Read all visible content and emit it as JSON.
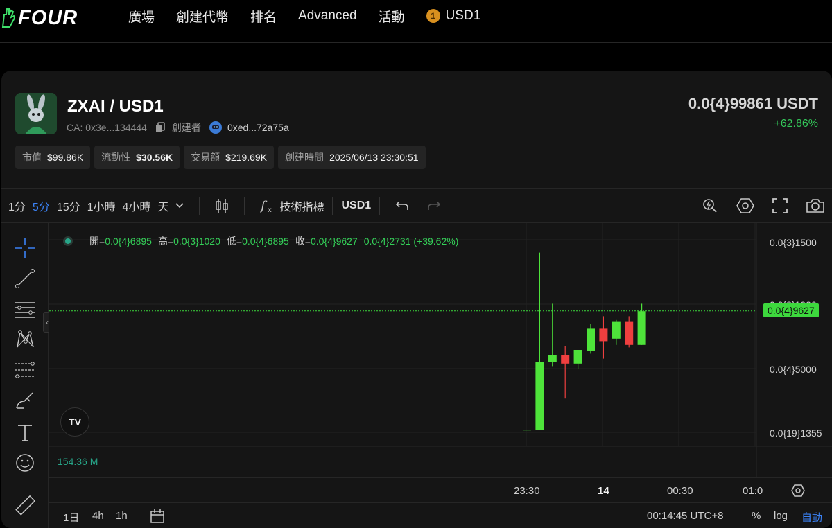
{
  "nav": {
    "logo_text": "FOUR",
    "items": [
      "廣場",
      "創建代幣",
      "排名",
      "Advanced",
      "活動"
    ],
    "token_badge": "1",
    "token_label": "USD1"
  },
  "token": {
    "pair": "ZXAI / USD1",
    "ca": "CA: 0x3e...134444",
    "creator_label": "創建者",
    "creator_address": "0xed...72a75a",
    "price": "0.0{4}99861 USDT",
    "change": "+62.86%"
  },
  "stats": [
    {
      "label": "市值",
      "value": "$99.86K",
      "bold": false
    },
    {
      "label": "流動性",
      "value": "$30.56K",
      "bold": true
    },
    {
      "label": "交易額",
      "value": "$219.69K",
      "bold": false
    },
    {
      "label": "創建時間",
      "value": "2025/06/13 23:30:51",
      "bold": false
    }
  ],
  "toolbar": {
    "timeframes": [
      "1分",
      "5分",
      "15分",
      "1小時",
      "4小時",
      "天"
    ],
    "active_timeframe": "5分",
    "indicators_label": "技術指標",
    "quote_label": "USD1"
  },
  "chart_data": {
    "type": "candlestick",
    "legend": {
      "open_label": "開=",
      "open": "0.0{4}6895",
      "high_label": "高=",
      "high": "0.0{3}1020",
      "low_label": "低=",
      "low": "0.0{4}6895",
      "close_label": "收=",
      "close": "0.0{4}9627",
      "change": "0.0{4}2731 (+39.62%)"
    },
    "y_tick_labels": [
      "0.0{3}1500",
      "0.0{3}1000",
      "0.0{4}5000",
      "0.0{19}1355"
    ],
    "current_price_label": "0.0{4}9627",
    "current_price": 9.627e-05,
    "x_tick_labels": [
      "23:30",
      "14",
      "00:30",
      "01:0"
    ],
    "ylim": [
      0,
      0.00015
    ],
    "candles": [
      {
        "open": 1e-06,
        "high": 1e-06,
        "low": 1e-06,
        "close": 1e-06
      },
      {
        "open": 1e-06,
        "high": 0.000143,
        "low": 1e-06,
        "close": 5.5e-05
      },
      {
        "open": 5.5e-05,
        "high": 0.000102,
        "low": 5.2e-05,
        "close": 6.1e-05
      },
      {
        "open": 6.1e-05,
        "high": 6.8e-05,
        "low": 2.6e-05,
        "close": 5.4e-05
      },
      {
        "open": 5.4e-05,
        "high": 6.4e-05,
        "low": 5e-05,
        "close": 6.5e-05
      },
      {
        "open": 6.4e-05,
        "high": 8.6e-05,
        "low": 6.2e-05,
        "close": 8.2e-05
      },
      {
        "open": 8.2e-05,
        "high": 9.2e-05,
        "low": 5.8e-05,
        "close": 7.2e-05
      },
      {
        "open": 7.4e-05,
        "high": 8.9e-05,
        "low": 6.9e-05,
        "close": 8.8e-05
      },
      {
        "open": 8.8e-05,
        "high": 9.2e-05,
        "low": 6.7e-05,
        "close": 6.9e-05
      },
      {
        "open": 6.9e-05,
        "high": 0.000102,
        "low": 6.9e-05,
        "close": 9.6e-05
      }
    ],
    "bull_color": "#4ee33a",
    "bear_color": "#ef3f3f",
    "volume_label": "154.36 M"
  },
  "bottom": {
    "ranges": [
      "1日",
      "4h",
      "1h"
    ],
    "clock": "00:14:45 UTC+8",
    "percent_label": "%",
    "log_label": "log",
    "auto_label": "自動"
  }
}
